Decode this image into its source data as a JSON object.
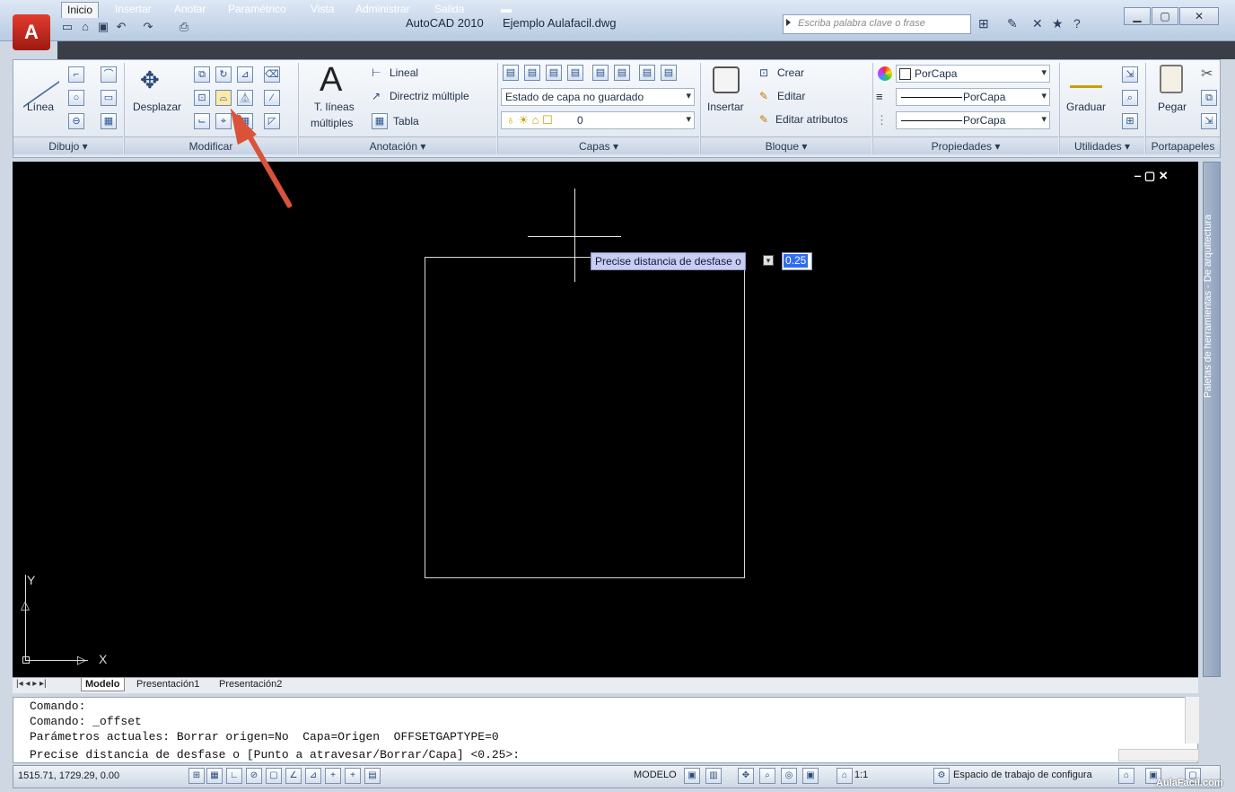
{
  "window": {
    "title": "AutoCAD 2010",
    "file": "Ejemplo Aulafacil.dwg",
    "search_placeholder": "Escriba palabra clave o frase"
  },
  "tabs": [
    "Inicio",
    "Insertar",
    "Anotar",
    "Paramétrico",
    "Vista",
    "Administrar",
    "Salida"
  ],
  "active_tab": "Inicio",
  "panels": {
    "dibujo": {
      "title": "Dibujo ▾",
      "linea": "Línea"
    },
    "modificar": {
      "title": "Modificar",
      "desplazar": "Desplazar"
    },
    "anotacion": {
      "title": "Anotación ▾",
      "tlineas_1": "T. líneas",
      "tlineas_2": "múltiples",
      "lineal": "Lineal",
      "directriz": "Directriz múltiple",
      "tabla": "Tabla"
    },
    "capas": {
      "title": "Capas ▾",
      "estado": "Estado de capa no guardado",
      "capa_actual": "0"
    },
    "bloque": {
      "title": "Bloque ▾",
      "insertar": "Insertar",
      "crear": "Crear",
      "editar": "Editar",
      "editar_atributos": "Editar atributos"
    },
    "propiedades": {
      "title": "Propiedades ▾",
      "color": "PorCapa",
      "tipo_linea": "PorCapa",
      "grosor": "PorCapa"
    },
    "utilidades": {
      "title": "Utilidades ▾",
      "graduar": "Graduar"
    },
    "portapapeles": {
      "title": "Portapapeles",
      "pegar": "Pegar"
    }
  },
  "drawing": {
    "tooltip_text": "Precise distancia de desfase o",
    "tooltip_value": "0.25",
    "ucs_x": "X",
    "ucs_y": "Y",
    "palette_label": "Paletas de herramientas - De arquitectura"
  },
  "layout_tabs": [
    "Modelo",
    "Presentación1",
    "Presentación2"
  ],
  "command_lines": [
    "Comando:",
    "Comando: _offset",
    "Parámetros actuales: Borrar origen=No  Capa=Origen  OFFSETGAPTYPE=0",
    "Precise distancia de desfase o [Punto a atravesar/Borrar/Capa] <0.25>:"
  ],
  "status": {
    "coords": "1515.71, 1729.29, 0.00",
    "modelo": "MODELO",
    "scale": "1:1",
    "workspace": "Espacio de trabajo de configura"
  },
  "watermark": "AulaFacil.com"
}
